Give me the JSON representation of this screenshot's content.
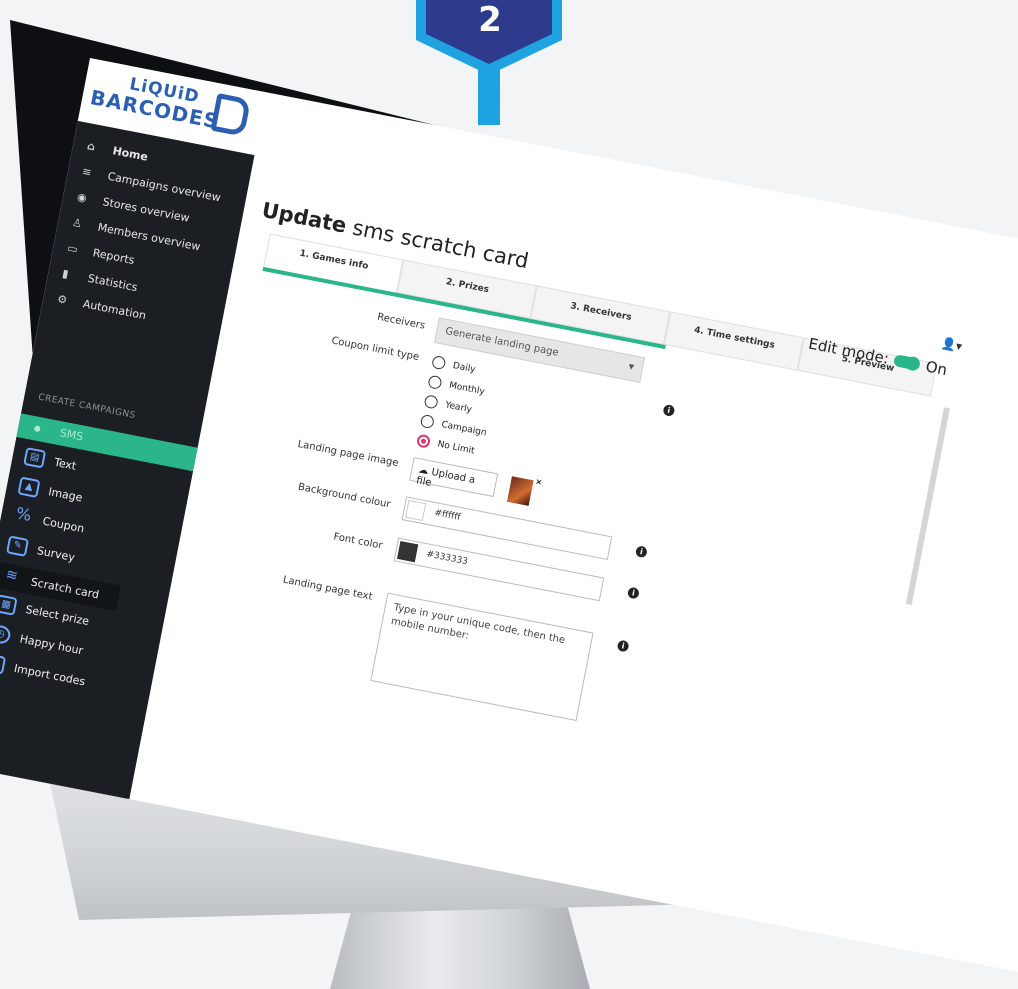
{
  "badge": {
    "number": "2",
    "color": "#2e3b8c"
  },
  "logo": {
    "line1": "LiQUiD",
    "line2": "BARCODES",
    "mark": "B"
  },
  "sidebar": {
    "items": [
      {
        "label": "Home",
        "icon": "home-icon"
      },
      {
        "label": "Campaigns overview",
        "icon": "list-icon"
      },
      {
        "label": "Stores overview",
        "icon": "map-pin-icon"
      },
      {
        "label": "Members overview",
        "icon": "person-icon"
      },
      {
        "label": "Reports",
        "icon": "folder-icon"
      },
      {
        "label": "Statistics",
        "icon": "bar-chart-icon"
      },
      {
        "label": "Automation",
        "icon": "gears-icon"
      }
    ],
    "section_label": "CREATE CAMPAIGNS",
    "active": "SMS",
    "campaign_items": [
      {
        "label": "Text",
        "icon": "chat-icon"
      },
      {
        "label": "Image",
        "icon": "image-icon"
      },
      {
        "label": "Coupon",
        "icon": "percent-icon"
      },
      {
        "label": "Survey",
        "icon": "edit-icon"
      },
      {
        "label": "Scratch card",
        "icon": "scratch-icon"
      },
      {
        "label": "Select prize",
        "icon": "grid-check-icon"
      },
      {
        "label": "Happy hour",
        "icon": "alarm-clock-icon"
      },
      {
        "label": "Import codes",
        "icon": "import-icon"
      }
    ]
  },
  "page": {
    "title_bold": "Update",
    "title_rest": "sms scratch card"
  },
  "tabs": [
    "1. Games info",
    "2. Prizes",
    "3. Receivers",
    "4. Time settings",
    "5. Preview"
  ],
  "edit_mode": {
    "label": "Edit mode:",
    "state": "On"
  },
  "form": {
    "receivers_label": "Receivers",
    "receivers_value": "Generate landing page",
    "coupon_limit_label": "Coupon limit type",
    "coupon_options": [
      "Daily",
      "Monthly",
      "Yearly",
      "Campaign",
      "No Limit"
    ],
    "coupon_selected": "No Limit",
    "landing_image_label": "Landing page image",
    "upload_label": "Upload a file",
    "bg_colour_label": "Background colour",
    "bg_colour_value": "#ffffff",
    "font_color_label": "Font color",
    "font_color_value": "#333333",
    "landing_text_label": "Landing page text",
    "landing_text_value": "Type in your unique code, then the mobile number:"
  },
  "colors": {
    "accent": "#2bb58a",
    "sidebar_bg": "#1b1f24",
    "radio_selected": "#e5336e",
    "brand": "#2b5fb3"
  }
}
